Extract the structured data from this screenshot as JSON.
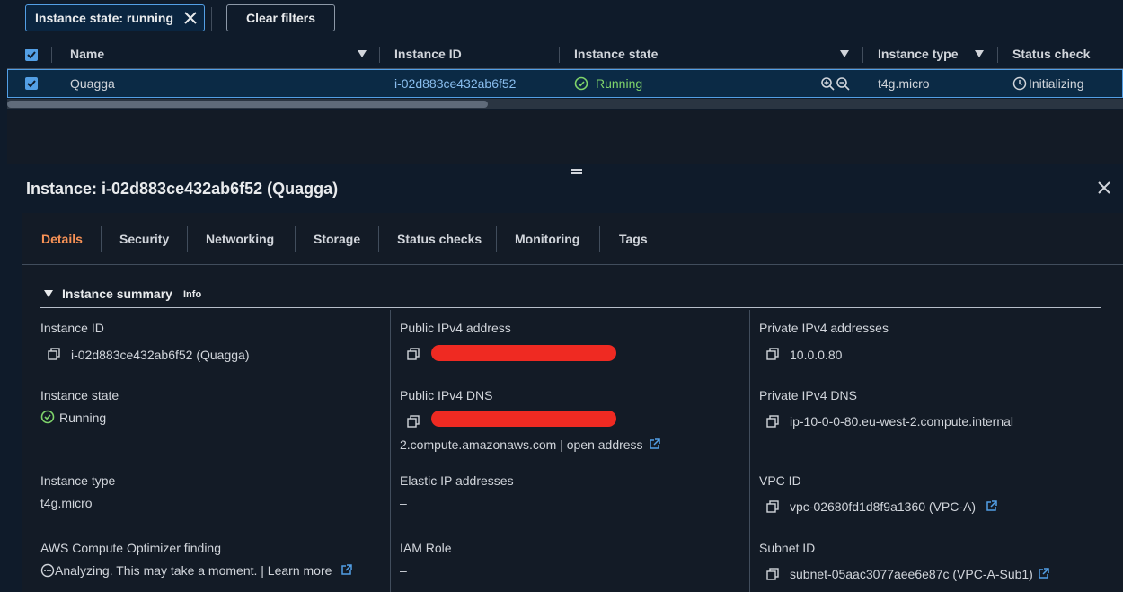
{
  "filters": {
    "token_label": "Instance state: running",
    "clear_label": "Clear filters"
  },
  "table": {
    "columns": [
      "Name",
      "Instance ID",
      "Instance state",
      "Instance type",
      "Status check"
    ],
    "row": {
      "name": "Quagga",
      "instance_id": "i-02d883ce432ab6f52",
      "state": "Running",
      "type": "t4g.micro",
      "status": "Initializing"
    }
  },
  "panel": {
    "title": "Instance: i-02d883ce432ab6f52 (Quagga)",
    "tabs": [
      "Details",
      "Security",
      "Networking",
      "Storage",
      "Status checks",
      "Monitoring",
      "Tags"
    ],
    "active_tab": "Details",
    "summary_label": "Instance summary",
    "info_label": "Info"
  },
  "summary": {
    "instance_id_label": "Instance ID",
    "instance_id_value": "i-02d883ce432ab6f52 (Quagga)",
    "public_ipv4_label": "Public IPv4 address",
    "private_ipv4_label": "Private IPv4 addresses",
    "private_ipv4_value": "10.0.0.80",
    "instance_state_label": "Instance state",
    "instance_state_value": "Running",
    "public_dns_label": "Public IPv4 DNS",
    "public_dns_suffix": "2.compute.amazonaws.com | open address",
    "private_dns_label": "Private IPv4 DNS",
    "private_dns_value": "ip-10-0-0-80.eu-west-2.compute.internal",
    "instance_type_label": "Instance type",
    "instance_type_value": "t4g.micro",
    "elastic_ip_label": "Elastic IP addresses",
    "elastic_ip_value": "–",
    "vpc_label": "VPC ID",
    "vpc_value": "vpc-02680fd1d8f9a1360 (VPC-A)",
    "optimizer_label": "AWS Compute Optimizer finding",
    "optimizer_value": "Analyzing. This may take a moment. | Learn more",
    "iam_label": "IAM Role",
    "iam_value": "–",
    "subnet_label": "Subnet ID",
    "subnet_value": "subnet-05aac3077aee6e87c (VPC-A-Sub1)"
  },
  "colors": {
    "accent_link": "#89bdee",
    "running_green": "#7fd46b",
    "active_tab": "#f89256",
    "selection_border": "#539fe5",
    "redaction": "#ef2a22"
  }
}
